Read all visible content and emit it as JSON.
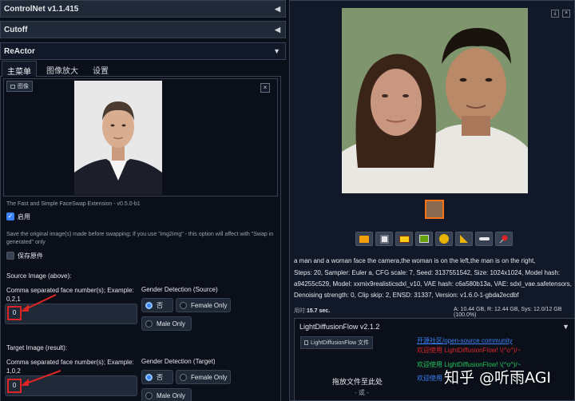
{
  "accordions": {
    "controlnet": "ControlNet v1.1.415",
    "cutoff": "Cutoff",
    "reactor": "ReActor"
  },
  "tabs": [
    "主菜单",
    "图像放大",
    "设置"
  ],
  "image_upload": {
    "label": "图像"
  },
  "extension_text": "The Fast and Simple FaceSwap Extension - v0.5.0-b1",
  "enable_label": "启用",
  "save_note": "Save the original image(s) made before swapping; If you use \"img2img\" - this option will affect with \"Swap in generated\" only",
  "save_original_label": "保存原件",
  "source": {
    "title": "Source Image (above):",
    "face_numbers_label": "Comma separated face number(s); Example: 0,2,1",
    "face_numbers_value": "0",
    "gender_label": "Gender Detection (Source)",
    "options": [
      "否",
      "Female Only",
      "Male Only"
    ]
  },
  "target": {
    "title": "Target Image (result):",
    "face_numbers_label": "Comma separated face number(s); Example: 1,0,2",
    "face_numbers_value": "0",
    "gender_label": "Gender Detection (Target)",
    "options": [
      "否",
      "Female Only",
      "Male Only"
    ]
  },
  "toolbar_icons": [
    "folder-icon",
    "save-icon",
    "zip-icon",
    "image-icon",
    "palette-icon",
    "triangle-ruler-icon",
    "send-icon",
    "pin-icon"
  ],
  "generation_info": [
    "a man and a woman face the camera,the woman is on the left,the man is on the right,",
    "Steps: 20, Sampler: Euler a, CFG scale: 7, Seed: 3137551542, Size: 1024x1024, Model hash:",
    "a94255c529, Model: xxmix9realisticsdxl_v10, VAE hash: c6a580b13a, VAE: sdxl_vae.safetensors,",
    "Denoising strength: 0, Clip skip: 2, ENSD: 31337, Version: v1.6.0-1-gbda2ecdbf"
  ],
  "timing": {
    "time_label": "用时:",
    "time_value": "15.7 sec.",
    "memory": "A: 10.44 GB, R: 12.44 GB, Sys: 12.0/12 GB (100.0%)"
  },
  "ldf": {
    "title": "LightDiffusionFlow v2.1.2",
    "file_button": "LightDiffusionFlow 文件",
    "community_link": "开源社区/open-source community",
    "welcome_red": "欢迎使用 LightDiffusionFlow! \\(^o^)/~",
    "welcome_green": "欢迎使用 LightDiffusionFlow! \\(^o^)/~",
    "welcome_blue": "欢迎使用",
    "drop_text": "拖放文件至此处",
    "or_text": "- 或 -"
  },
  "watermark": "知乎 @听雨AGI"
}
